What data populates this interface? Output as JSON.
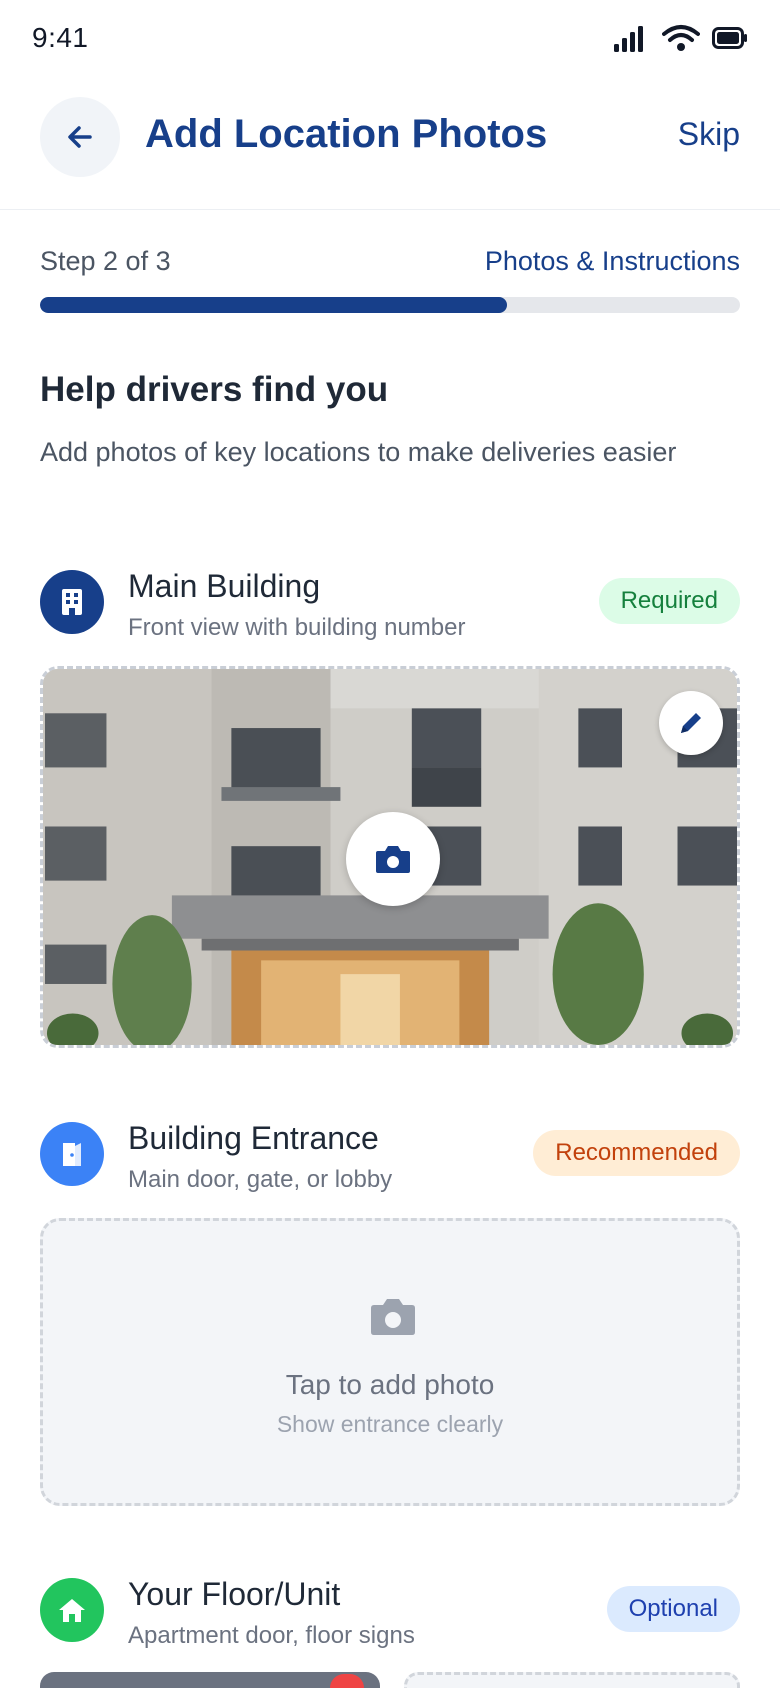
{
  "status": {
    "time": "9:41"
  },
  "header": {
    "title": "Add Location Photos",
    "skip_label": "Skip"
  },
  "progress": {
    "step_label": "Step 2 of 3",
    "step_name": "Photos & Instructions",
    "fraction": 0.667
  },
  "intro": {
    "heading": "Help drivers find you",
    "text": "Add photos of key locations to make deliveries easier"
  },
  "sections": [
    {
      "title": "Main Building",
      "subtitle": "Front view with building number",
      "badge": "Required",
      "icon": "building-icon",
      "icon_color": "#173f8a"
    },
    {
      "title": "Building Entrance",
      "subtitle": "Main door, gate, or lobby",
      "badge": "Recommended",
      "icon": "door-icon",
      "icon_color": "#3b82f6",
      "upload": {
        "label": "Tap to add photo",
        "hint": "Show entrance clearly"
      }
    },
    {
      "title": "Your Floor/Unit",
      "subtitle": "Apartment door, floor signs",
      "badge": "Optional",
      "icon": "home-icon",
      "icon_color": "#22c55e"
    }
  ],
  "colors": {
    "primary": "#173f8a",
    "required": "#15803d",
    "recommended": "#c2410c",
    "optional": "#1e40af"
  }
}
